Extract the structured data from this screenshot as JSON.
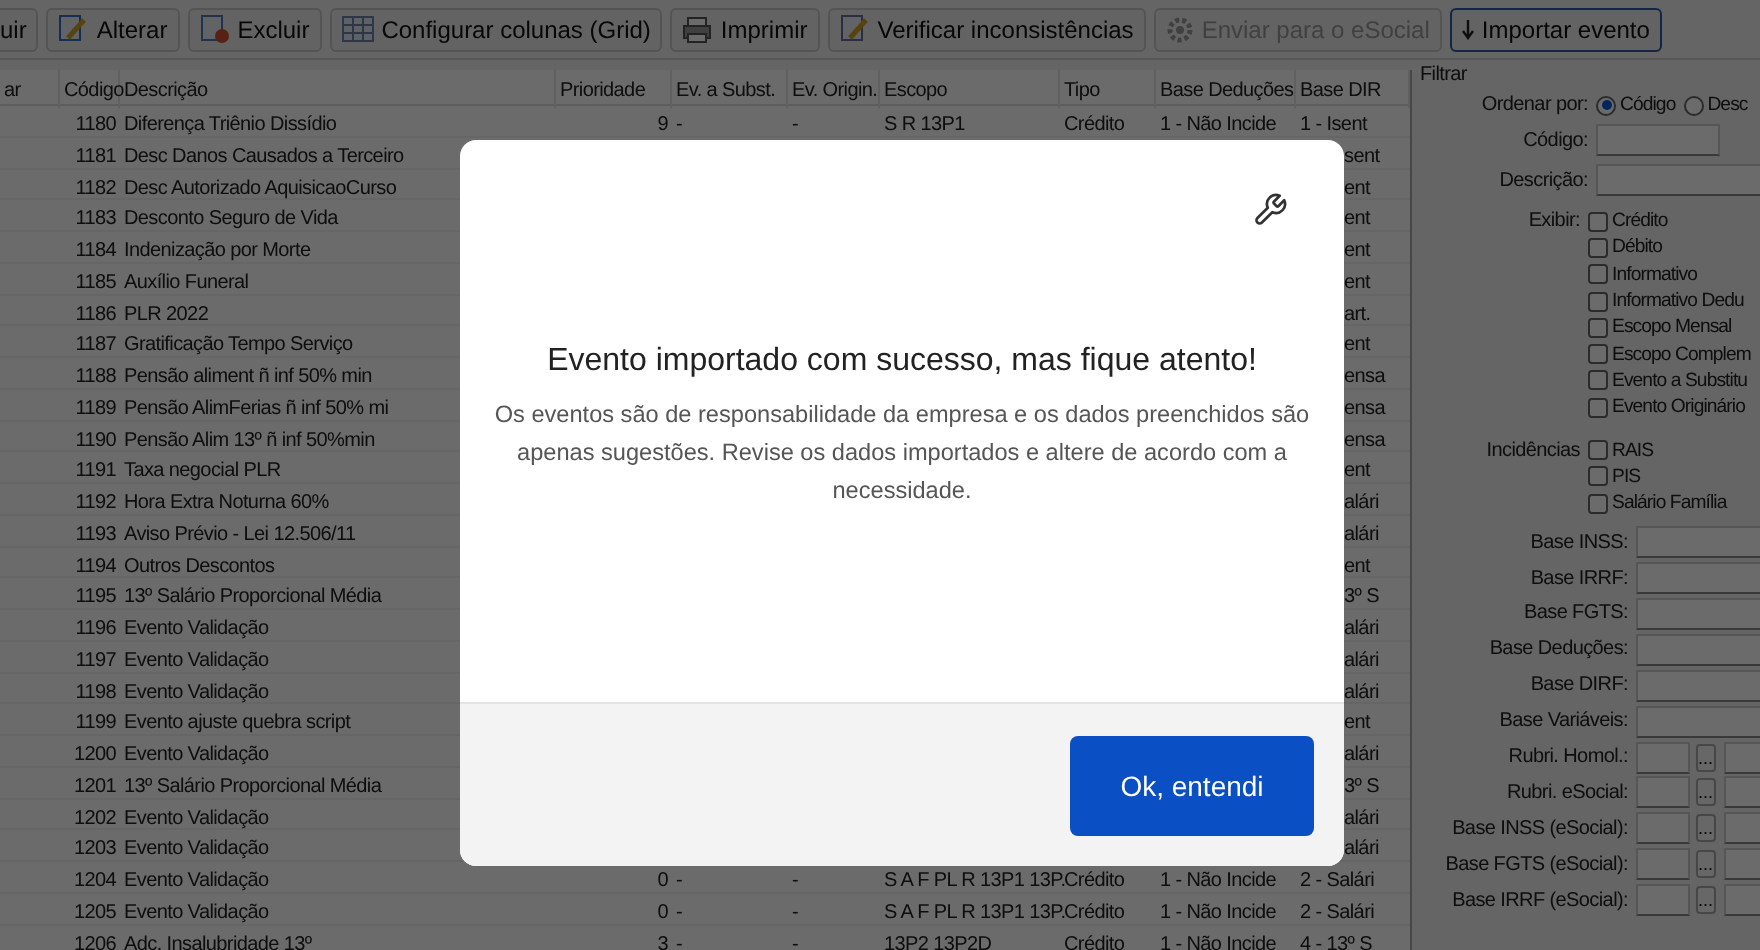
{
  "toolbar": [
    {
      "label": "uir",
      "disabled": false,
      "kind": "plain"
    },
    {
      "label": "Alterar",
      "disabled": false,
      "kind": "edit"
    },
    {
      "label": "Excluir",
      "disabled": false,
      "kind": "delete"
    },
    {
      "label": "Configurar colunas (Grid)",
      "disabled": false,
      "kind": "grid"
    },
    {
      "label": "Imprimir",
      "disabled": false,
      "kind": "print"
    },
    {
      "label": "Verificar inconsistências",
      "disabled": false,
      "kind": "check"
    },
    {
      "label": "Enviar para o eSocial",
      "disabled": true,
      "kind": "send"
    },
    {
      "label": "Importar evento",
      "disabled": false,
      "kind": "import"
    }
  ],
  "table": {
    "columns": [
      "ar",
      "Código",
      "Descrição",
      "Prioridade",
      "Ev. a Subst.",
      "Ev. Origin.",
      "Escopo",
      "Tipo",
      "Base Deduções",
      "Base DIR"
    ],
    "rows": [
      {
        "code": "1180",
        "description": "Diferença Triênio Dissídio",
        "priority": "9",
        "ev_subst": "-",
        "ev_origin": "-",
        "scope": "S R 13P1",
        "type": "Crédito",
        "base_deductions": "1 - Não Incide",
        "base_dirf": "1 - Isent"
      },
      {
        "code": "1181",
        "description": "Desc Danos Causados a Terceiro",
        "base_dirf": "sent"
      },
      {
        "code": "1182",
        "description": "Desc Autorizado AquisicaoCurso",
        "base_dirf": "ent"
      },
      {
        "code": "1183",
        "description": "Desconto Seguro de Vida",
        "base_dirf": "ent"
      },
      {
        "code": "1184",
        "description": "Indenização por Morte",
        "base_dirf": "ent"
      },
      {
        "code": "1185",
        "description": "Auxílio Funeral",
        "base_dirf": "ent"
      },
      {
        "code": "1186",
        "description": "PLR 2022",
        "base_dirf": "art."
      },
      {
        "code": "1187",
        "description": "Gratificação Tempo Serviço",
        "base_dirf": "ent"
      },
      {
        "code": "1188",
        "description": "Pensão aliment ñ inf 50% min",
        "base_dirf": "ensa"
      },
      {
        "code": "1189",
        "description": "Pensão AlimFerias ñ inf 50% mi",
        "base_dirf": "ensa"
      },
      {
        "code": "1190",
        "description": "Pensão Alim 13º ñ inf 50%min",
        "base_dirf": "ensa"
      },
      {
        "code": "1191",
        "description": "Taxa negocial PLR",
        "base_dirf": "ent"
      },
      {
        "code": "1192",
        "description": "Hora Extra Noturna 60%",
        "base_dirf": "alári"
      },
      {
        "code": "1193",
        "description": "Aviso Prévio - Lei 12.506/11",
        "base_dirf": "alári"
      },
      {
        "code": "1194",
        "description": "Outros Descontos",
        "base_dirf": "ent"
      },
      {
        "code": "1195",
        "description": "13º Salário Proporcional Média",
        "base_dirf": "3º S"
      },
      {
        "code": "1196",
        "description": "Evento Validação",
        "base_dirf": "alári"
      },
      {
        "code": "1197",
        "description": "Evento Validação",
        "base_dirf": "alári"
      },
      {
        "code": "1198",
        "description": "Evento Validação",
        "base_dirf": "alári"
      },
      {
        "code": "1199",
        "description": "Evento ajuste quebra script",
        "base_dirf": "ent"
      },
      {
        "code": "1200",
        "description": "Evento Validação",
        "base_dirf": "alári"
      },
      {
        "code": "1201",
        "description": "13º Salário Proporcional Média",
        "base_dirf": "3º S"
      },
      {
        "code": "1202",
        "description": "Evento Validação",
        "base_dirf": "alári"
      },
      {
        "code": "1203",
        "description": "Evento Validação",
        "base_dirf": "alári"
      },
      {
        "code": "1204",
        "description": "Evento Validação",
        "priority": "0",
        "ev_subst": "-",
        "ev_origin": "-",
        "scope": "S A F PL R 13P1 13P.",
        "type": "Crédito",
        "base_deductions": "1 - Não Incide",
        "base_dirf": "2 - Salári"
      },
      {
        "code": "1205",
        "description": "Evento Validação",
        "priority": "0",
        "ev_subst": "-",
        "ev_origin": "-",
        "scope": "S A F PL R 13P1 13P.",
        "type": "Crédito",
        "base_deductions": "1 - Não Incide",
        "base_dirf": "2 - Salári"
      },
      {
        "code": "1206",
        "description": "Adc. Insalubridade 13º",
        "priority": "3",
        "ev_subst": "-",
        "ev_origin": "-",
        "scope": "13P2 13P2D",
        "type": "Crédito",
        "base_deductions": "1 - Não Incide",
        "base_dirf": "4 - 13º S"
      }
    ]
  },
  "filter": {
    "title": "Filtrar",
    "sort": {
      "label": "Ordenar por:",
      "options": [
        {
          "label": "Código",
          "selected": true
        },
        {
          "label": "Desc",
          "selected": false
        }
      ]
    },
    "fields": [
      {
        "label": "Código:"
      },
      {
        "label": "Descrição:"
      }
    ],
    "show": {
      "label": "Exibir:",
      "options": [
        {
          "label": "Crédito",
          "checked": false
        },
        {
          "label": "Débito",
          "checked": false
        },
        {
          "label": "Informativo",
          "checked": false
        },
        {
          "label": "Informativo Dedu",
          "checked": false
        },
        {
          "label": "Escopo Mensal",
          "checked": false
        },
        {
          "label": "Escopo Complem",
          "checked": false
        },
        {
          "label": "Evento a Substitu",
          "checked": false
        },
        {
          "label": "Evento Originário",
          "checked": false
        }
      ]
    },
    "incidences": {
      "label": "Incidências",
      "options": [
        {
          "label": "RAIS",
          "checked": false
        },
        {
          "label": "PIS",
          "checked": false
        },
        {
          "label": "Salário Família",
          "checked": false
        }
      ]
    },
    "bases": [
      {
        "label": "Base INSS:",
        "kind": "text"
      },
      {
        "label": "Base IRRF:",
        "kind": "text"
      },
      {
        "label": "Base FGTS:",
        "kind": "text"
      },
      {
        "label": "Base Deduções:",
        "kind": "text"
      },
      {
        "label": "Base DIRF:",
        "kind": "text"
      },
      {
        "label": "Base Variáveis:",
        "kind": "text"
      },
      {
        "label": "Rubri. Homol.:",
        "kind": "lookup",
        "button": "..."
      },
      {
        "label": "Rubri. eSocial:",
        "kind": "lookup",
        "button": "..."
      },
      {
        "label": "Base INSS (eSocial):",
        "kind": "lookup",
        "button": "..."
      },
      {
        "label": "Base FGTS (eSocial):",
        "kind": "lookup",
        "button": "..."
      },
      {
        "label": "Base IRRF (eSocial):",
        "kind": "lookup",
        "button": "..."
      }
    ]
  },
  "dialog": {
    "title": "Evento importado com sucesso, mas fique atento!",
    "message": "Os eventos são de responsabilidade da empresa e os dados preenchidos são apenas sugestões. Revise os dados importados e altere de acordo com a necessidade.",
    "button": "Ok, entendi"
  }
}
